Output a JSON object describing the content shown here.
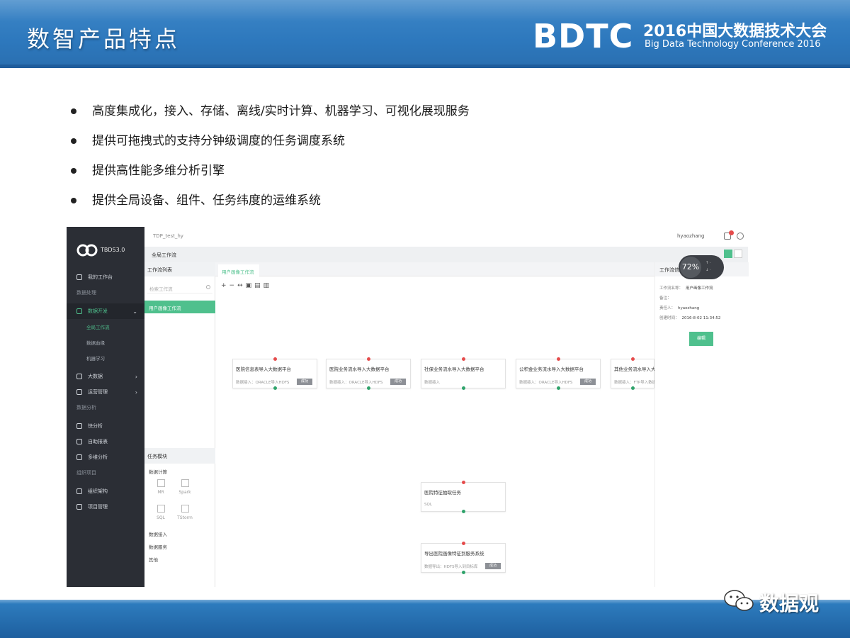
{
  "slide": {
    "title": "数智产品特点",
    "conference": {
      "logo": "BDTC",
      "title_cn": "2016中国大数据技术大会",
      "title_en": "Big Data Technology Conference 2016"
    },
    "bullets": [
      "高度集成化，接入、存储、离线/实时计算、机器学习、可视化展现服务",
      "提供可拖拽式的支持分钟级调度的任务调度系统",
      "提供高性能多维分析引擎",
      "提供全局设备、组件、任务纬度的运维系统"
    ],
    "watermark": "数据观"
  },
  "app": {
    "brand": "TBDS3.0",
    "top": {
      "crumb": "TDP_test_hy",
      "user": "hyaozhang"
    },
    "subheader": {
      "title": "全局工作流"
    },
    "sidebar": {
      "items": [
        {
          "label": "我的工作台",
          "kind": "item",
          "icon": "person-icon"
        },
        {
          "label": "数据处理",
          "kind": "group"
        },
        {
          "label": "数据开发",
          "kind": "active",
          "icon": "clock-icon"
        },
        {
          "label": "全局工作流",
          "kind": "sub"
        },
        {
          "label": "数据血缘",
          "kind": "sub-dim"
        },
        {
          "label": "机器学习",
          "kind": "sub-dim"
        },
        {
          "label": "大数据",
          "kind": "item",
          "icon": "chart-icon"
        },
        {
          "label": "运营管理",
          "kind": "item",
          "icon": "wrench-icon"
        },
        {
          "label": "数据分析",
          "kind": "group"
        },
        {
          "label": "快分析",
          "kind": "item",
          "icon": "clock-icon"
        },
        {
          "label": "自助报表",
          "kind": "item",
          "icon": "report-icon"
        },
        {
          "label": "多维分析",
          "kind": "item",
          "icon": "cube-icon"
        },
        {
          "label": "组织项目",
          "kind": "group"
        },
        {
          "label": "组织架构",
          "kind": "item",
          "icon": "gear-icon"
        },
        {
          "label": "项目管理",
          "kind": "item",
          "icon": "user-group-icon"
        }
      ]
    },
    "workflow_panel": {
      "header": "工作流列表",
      "search_placeholder": "检索工作流",
      "selected": "用户画像工作流",
      "tasks_header": "任务模块",
      "tree": [
        "数据计算",
        "数据接入",
        "数据服务",
        "其他"
      ],
      "tools": [
        "MR",
        "Spark",
        "SQL",
        "TStorm"
      ]
    },
    "canvas": {
      "tab": "用户画像工作流",
      "nodes": [
        {
          "title": "医院信息表导入大数据平台",
          "subtitle": "数据接入：ORACLE导入HDFS",
          "badge": "成功",
          "col": 0,
          "row": 0
        },
        {
          "title": "医院业务流水导入大数据平台",
          "subtitle": "数据接入：ORACLE导入HDFS",
          "badge": "成功",
          "col": 1,
          "row": 0
        },
        {
          "title": "社保业务流水导入大数据平台",
          "subtitle": "数据接入",
          "badge": "",
          "col": 2,
          "row": 0
        },
        {
          "title": "公积金业务流水导入大数据平台",
          "subtitle": "数据接入：ORACLE导入HDFS",
          "badge": "成功",
          "col": 3,
          "row": 0
        },
        {
          "title": "其他业务流水导入大数据平台",
          "subtitle": "数据接入：FTP导入数据",
          "badge": "",
          "col": 4,
          "row": 0
        },
        {
          "title": "医院特征抽取任务",
          "subtitle": "SQL",
          "badge": "",
          "col": 2,
          "row": 1
        },
        {
          "title": "导出医院画像特征到服务系统",
          "subtitle": "数据导出：HDFS导入到目标库",
          "badge": "成功",
          "col": 2,
          "row": 2
        }
      ]
    },
    "properties": {
      "header": "工作流信息",
      "rows": [
        {
          "label": "工作流名称：",
          "value": "用户画像工作流"
        },
        {
          "label": "备注：",
          "value": ""
        },
        {
          "label": "责任人：",
          "value": "hyaozhang"
        },
        {
          "label": "创建时间：",
          "value": "2016-8-02 11:34:52"
        }
      ],
      "button": "编辑"
    },
    "gauge": {
      "value": "72%"
    }
  }
}
